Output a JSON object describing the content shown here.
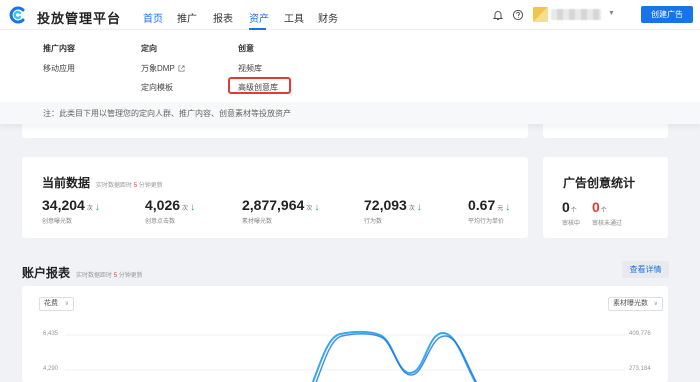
{
  "app": {
    "title": "投放管理平台"
  },
  "nav": {
    "items": [
      "首页",
      "推广",
      "报表",
      "资产",
      "工具",
      "财务"
    ],
    "selected": "资产",
    "create_button": "创建广告"
  },
  "menu": {
    "col1": {
      "header": "推广内容",
      "items": [
        "移动应用"
      ]
    },
    "col2": {
      "header": "定向",
      "items": [
        "万象DMP",
        "定向模板"
      ]
    },
    "col3": {
      "header": "创意",
      "items": [
        "视频库",
        "高级创意库"
      ]
    },
    "highlighted_item": "高级创意库",
    "note": "注：此类目下用以管理您的定向人群、推广内容、创意素材等投放资产"
  },
  "current_data": {
    "title": "当前数据",
    "hint_prefix": "实时数据距时",
    "hint_num": "5",
    "hint_suffix": "分钟更新",
    "metrics": [
      {
        "value": "34,204",
        "unit": "次",
        "label": "创意曝光数"
      },
      {
        "value": "4,026",
        "unit": "次",
        "label": "创意点击数"
      },
      {
        "value": "2,877,964",
        "unit": "次",
        "label": "素材曝光数"
      },
      {
        "value": "72,093",
        "unit": "次",
        "label": "行为数"
      },
      {
        "value": "0.67",
        "unit": "元",
        "label": "平均行为单价"
      }
    ]
  },
  "creative_stats": {
    "title": "广告创意统计",
    "items": [
      {
        "value": "0",
        "unit": "个",
        "label": "审核中",
        "color": "#222222"
      },
      {
        "value": "0",
        "unit": "个",
        "label": "审核未通过",
        "color": "#e53935"
      }
    ]
  },
  "account_report": {
    "title": "账户报表",
    "hint_prefix": "实时数据距时",
    "hint_num": "5",
    "hint_suffix": "分钟更新",
    "detail_button": "查看详情",
    "left_select": "花费",
    "right_select": "素材曝光数",
    "left_ticks": [
      "6,435",
      "4,290"
    ],
    "right_ticks": [
      "409,776",
      "273,184"
    ]
  },
  "colors": {
    "accent": "#1a73e8",
    "danger": "#e53935",
    "up": "#21a366"
  }
}
